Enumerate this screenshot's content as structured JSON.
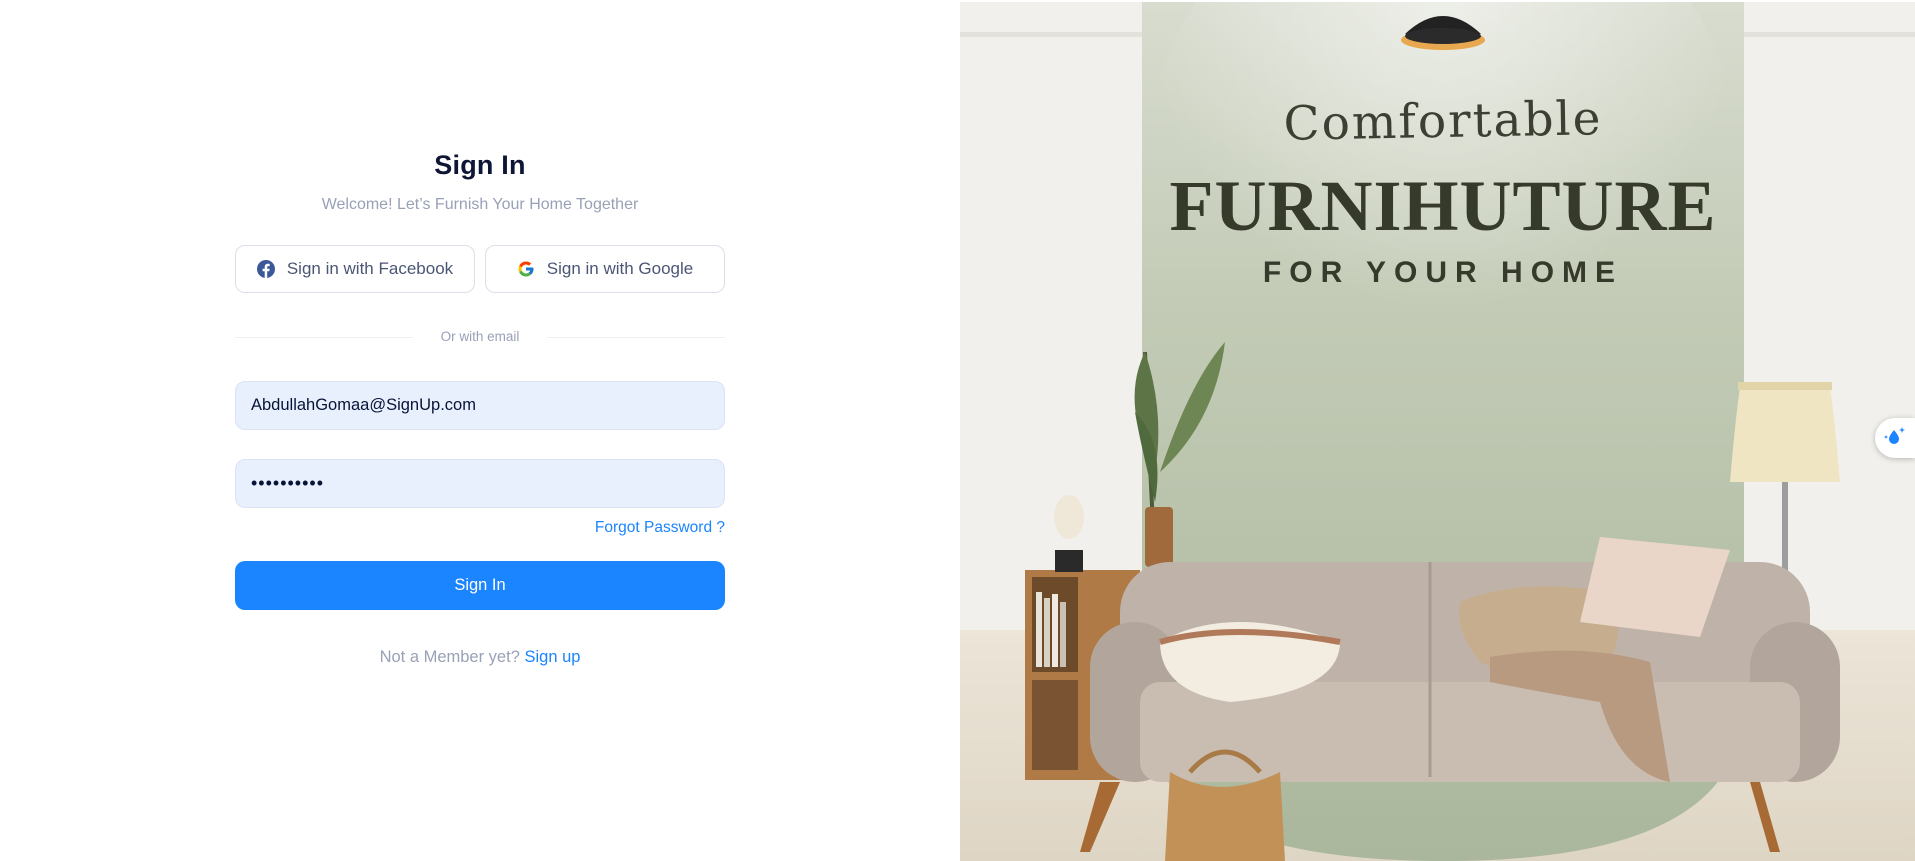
{
  "signin": {
    "title": "Sign In",
    "subtitle": "Welcome! Let’s Furnish Your Home Together",
    "facebook_label": "Sign in with Facebook",
    "google_label": "Sign in with Google",
    "divider_text": "Or with email",
    "email_value": "AbdullahGomaa@SignUp.com",
    "password_value": "••••••••••",
    "forgot_label": "Forgot Password ?",
    "submit_label": "Sign In",
    "footer_text": "Not a Member yet?",
    "signup_label": "Sign up"
  },
  "promo": {
    "line1": "Comfortable",
    "line2": "FURNIHUTURE",
    "line3": "FOR YOUR HOME"
  },
  "icons": {
    "facebook": "facebook-icon",
    "google": "google-icon",
    "floating": "sparkle-droplet-icon"
  },
  "colors": {
    "primary": "#1b84ff",
    "title": "#0f1535",
    "muted": "#99a1b7",
    "input_bg": "#e8f0fe",
    "facebook": "#3b5998",
    "promo_wall": "#b5c0a6"
  }
}
